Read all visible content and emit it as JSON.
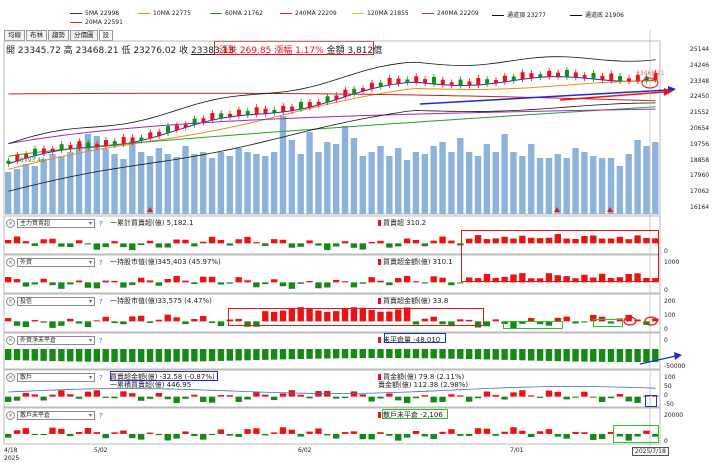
{
  "legend": [
    {
      "label": "5MA 22998",
      "color": "#1c2bd8"
    },
    {
      "label": "10MA 22775",
      "color": "#f08a1a"
    },
    {
      "label": "60MA 21762",
      "color": "#2aa02a"
    },
    {
      "label": "240MA 22209",
      "color": "#e52020"
    },
    {
      "label": "120MA 21855",
      "color": "#f3c13a"
    },
    {
      "label": "240MA 22209",
      "color": "#9a2ac4"
    },
    {
      "label": "通道頂 23277",
      "color": "#111111"
    },
    {
      "label": "通道底 21906",
      "color": "#111111"
    },
    {
      "label": "20MA 22591",
      "color": "#e52020"
    }
  ],
  "tabs": [
    "均線",
    "布林",
    "趨勢",
    "分價圖",
    "設"
  ],
  "quote": {
    "open_label": "開",
    "open": "23345.72",
    "high_label": "高",
    "high": "23468.21",
    "low_label": "低",
    "low": "23276.02",
    "close_label": "收",
    "close": "23383.13",
    "change": "漲跌 269.85",
    "pct": "漲幅 1.17%",
    "amount": "金額 3,812億"
  },
  "price_axis": [
    "25144",
    "24246",
    "23348",
    "22450",
    "21552",
    "20654",
    "19756",
    "18858",
    "17960",
    "17062",
    "16164"
  ],
  "low_marker": "18793.43",
  "high_marker": "23468.21",
  "dates": [
    {
      "label": "4/18",
      "sub": "2025"
    },
    {
      "label": "5/02",
      "sub": ""
    },
    {
      "label": "6/02",
      "sub": ""
    },
    {
      "label": "7/01",
      "sub": ""
    },
    {
      "label": "2025/7/18",
      "sub": ""
    }
  ],
  "panels": [
    {
      "select": "主力買賣超",
      "stat1": "一累計買賣超(億) 5,182.1",
      "stat2": "買賣超 310.2",
      "axis": [
        "",
        "0"
      ]
    },
    {
      "select": "外資",
      "stat1": "一持股市值(億)345,403 (45.97%)",
      "stat2": "買賣超金額(億) 310.1",
      "axis": [
        "1000",
        "0"
      ]
    },
    {
      "select": "投信",
      "stat1": "一持股市值(億)33,575 (4.47%)",
      "stat2": "買賣超金額(億) 33.8",
      "axis": [
        "200",
        "100",
        "0"
      ]
    },
    {
      "select": "外資淨未平倉",
      "stat1": "",
      "stat2": "未平倉量 -48,010",
      "axis": [
        "0",
        "-50000"
      ]
    },
    {
      "select": "散戶",
      "stat1": "買賣超金額(億) -32.58 (-0.87%)",
      "stat1b": "一累積買賣超(億) 446.95",
      "stat2": "買金額(億) 79.8 (2.11%)",
      "stat2b": "賣金額(億) 112.38 (2.98%)",
      "axis": [
        "100",
        "50",
        "0",
        "-50"
      ]
    },
    {
      "select": "散戶未平倉",
      "stat1": "",
      "stat2": "散戶未平倉 -2,106",
      "axis": [
        "20000",
        "0"
      ]
    }
  ],
  "chart_data": {
    "type": "candlestick",
    "title": "",
    "ylim": [
      16164,
      25144
    ],
    "volume": [
      0.42,
      0.45,
      0.5,
      0.48,
      0.55,
      0.6,
      0.58,
      0.62,
      0.7,
      0.8,
      0.78,
      0.65,
      0.6,
      0.55,
      0.72,
      0.62,
      0.58,
      0.66,
      0.6,
      0.57,
      0.68,
      0.6,
      0.62,
      0.56,
      0.62,
      0.58,
      0.66,
      0.62,
      0.6,
      0.58,
      0.62,
      0.98,
      0.74,
      0.6,
      0.82,
      0.62,
      0.72,
      0.7,
      0.88,
      0.76,
      0.58,
      0.62,
      0.68,
      0.58,
      0.66,
      0.54,
      0.62,
      0.6,
      0.68,
      0.72,
      0.62,
      0.76,
      0.62,
      0.58,
      0.7,
      0.62,
      0.8,
      0.62,
      0.58,
      0.7,
      0.56,
      0.56,
      0.6,
      0.56,
      0.66,
      0.62,
      0.58,
      0.56,
      0.56,
      0.48,
      0.6,
      0.74,
      0.68,
      0.72
    ]
  }
}
